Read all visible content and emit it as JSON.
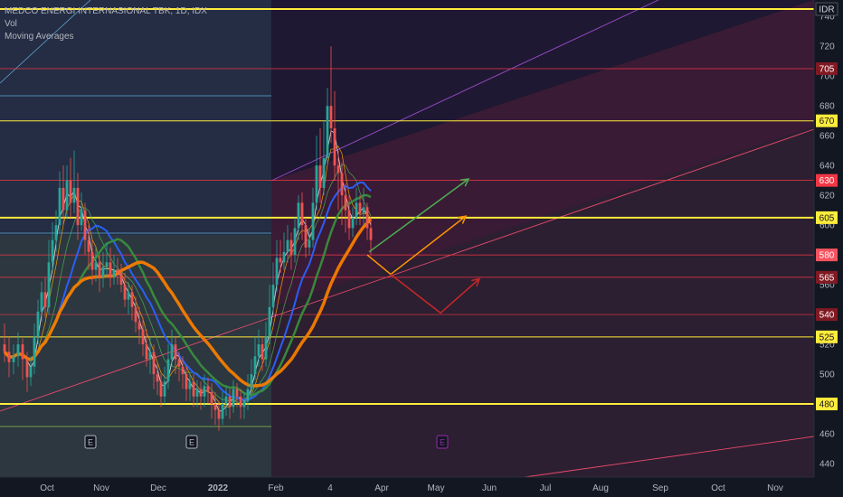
{
  "legend": {
    "title": "MEDCO ENERGI INTERNASIONAL TBK, 1D, IDX",
    "indicator_1": "Vol",
    "indicator_2": "Moving Averages"
  },
  "chart_data": {
    "type": "candlestick",
    "currency": "IDR",
    "y_ticks": [
      440,
      460,
      480,
      500,
      520,
      540,
      560,
      580,
      600,
      620,
      640,
      660,
      680,
      700,
      720,
      740
    ],
    "ylim": [
      432,
      745
    ],
    "x_ticks": [
      {
        "label": "Oct",
        "pos": 52
      },
      {
        "label": "Nov",
        "pos": 112
      },
      {
        "label": "Dec",
        "pos": 175
      },
      {
        "label": "2022",
        "pos": 241
      },
      {
        "label": "Feb",
        "pos": 305
      },
      {
        "label": "4",
        "pos": 365
      },
      {
        "label": "Apr",
        "pos": 422
      },
      {
        "label": "May",
        "pos": 482
      },
      {
        "label": "Jun",
        "pos": 541
      },
      {
        "label": "Jul",
        "pos": 603
      },
      {
        "label": "Aug",
        "pos": 664
      },
      {
        "label": "Sep",
        "pos": 730
      },
      {
        "label": "Oct",
        "pos": 794
      },
      {
        "label": "Nov",
        "pos": 857
      }
    ],
    "horizontal_levels": [
      {
        "value": 745,
        "color": "#ffeb3b",
        "width": 2
      },
      {
        "value": 705,
        "color": "#f23645",
        "width": 0.7
      },
      {
        "value": 670,
        "color": "#ffeb3b",
        "width": 1
      },
      {
        "value": 630,
        "color": "#f23645",
        "width": 0.7
      },
      {
        "value": 605,
        "color": "#ffeb3b",
        "width": 2
      },
      {
        "value": 580,
        "color": "#f23645",
        "width": 0.7
      },
      {
        "value": 565,
        "color": "#f23645",
        "width": 0.7
      },
      {
        "value": 540,
        "color": "#f23645",
        "width": 0.7
      },
      {
        "value": 525,
        "color": "#ffeb3b",
        "width": 1
      },
      {
        "value": 480,
        "color": "#ffeb3b",
        "width": 2
      }
    ],
    "price_tags": [
      {
        "label": "IDR",
        "value": 745,
        "bg": "#131722",
        "fg": "#d1d4dc"
      },
      {
        "label": "705",
        "value": 705,
        "bg": "#801922",
        "fg": "#ffffff"
      },
      {
        "label": "670",
        "value": 670,
        "bg": "#ffeb3b",
        "fg": "#131722"
      },
      {
        "label": "630",
        "value": 630,
        "bg": "#f23645",
        "fg": "#ffffff"
      },
      {
        "label": "605",
        "value": 605,
        "bg": "#ffeb3b",
        "fg": "#131722"
      },
      {
        "label": "580",
        "value": 580,
        "bg": "#f7525f",
        "fg": "#ffffff"
      },
      {
        "label": "565",
        "value": 565,
        "bg": "#801922",
        "fg": "#ffffff"
      },
      {
        "label": "540",
        "value": 540,
        "bg": "#801922",
        "fg": "#ffffff"
      },
      {
        "label": "525",
        "value": 525,
        "bg": "#ffeb3b",
        "fg": "#131722"
      },
      {
        "label": "480",
        "value": 480,
        "bg": "#ffeb3b",
        "fg": "#131722"
      }
    ],
    "earnings_markers": [
      {
        "label": "E",
        "pos": 100,
        "color": "#b2b5be"
      },
      {
        "label": "E",
        "pos": 212,
        "color": "#b2b5be"
      },
      {
        "label": "E",
        "pos": 489,
        "color": "#9c27b0"
      }
    ],
    "candles": [
      [
        5,
        520,
        515,
        534,
        508
      ],
      [
        10,
        515,
        508,
        525,
        498
      ],
      [
        15,
        508,
        512,
        520,
        500
      ],
      [
        20,
        512,
        520,
        528,
        505
      ],
      [
        25,
        520,
        510,
        524,
        496
      ],
      [
        30,
        510,
        498,
        515,
        488
      ],
      [
        34,
        498,
        505,
        512,
        492
      ],
      [
        38,
        505,
        525,
        534,
        500
      ],
      [
        42,
        525,
        542,
        550,
        520
      ],
      [
        46,
        542,
        555,
        562,
        535
      ],
      [
        50,
        555,
        545,
        565,
        538
      ],
      [
        54,
        545,
        575,
        590,
        540
      ],
      [
        58,
        575,
        590,
        602,
        570
      ],
      [
        62,
        590,
        600,
        610,
        582
      ],
      [
        66,
        600,
        625,
        636,
        595
      ],
      [
        70,
        625,
        610,
        640,
        600
      ],
      [
        74,
        610,
        630,
        640,
        604
      ],
      [
        78,
        630,
        615,
        645,
        605
      ],
      [
        82,
        615,
        625,
        650,
        608
      ],
      [
        86,
        625,
        600,
        635,
        590
      ],
      [
        90,
        600,
        610,
        622,
        596
      ],
      [
        94,
        610,
        590,
        615,
        580
      ],
      [
        98,
        590,
        582,
        600,
        570
      ],
      [
        102,
        582,
        570,
        590,
        560
      ],
      [
        106,
        570,
        575,
        585,
        562
      ],
      [
        110,
        575,
        565,
        580,
        555
      ],
      [
        114,
        565,
        572,
        582,
        558
      ],
      [
        118,
        572,
        575,
        588,
        565
      ],
      [
        122,
        575,
        565,
        585,
        558
      ],
      [
        126,
        565,
        570,
        580,
        560
      ],
      [
        130,
        570,
        568,
        578,
        560
      ],
      [
        134,
        568,
        560,
        574,
        555
      ],
      [
        138,
        560,
        550,
        568,
        545
      ],
      [
        142,
        550,
        555,
        562,
        540
      ],
      [
        146,
        555,
        545,
        560,
        536
      ],
      [
        150,
        545,
        535,
        552,
        528
      ],
      [
        154,
        535,
        530,
        545,
        520
      ],
      [
        158,
        530,
        520,
        538,
        512
      ],
      [
        162,
        520,
        510,
        530,
        505
      ],
      [
        166,
        510,
        515,
        525,
        500
      ],
      [
        170,
        515,
        500,
        520,
        490
      ],
      [
        174,
        500,
        495,
        508,
        486
      ],
      [
        178,
        495,
        485,
        500,
        478
      ],
      [
        182,
        485,
        495,
        505,
        480
      ],
      [
        186,
        495,
        510,
        520,
        490
      ],
      [
        190,
        510,
        520,
        530,
        505
      ],
      [
        194,
        520,
        510,
        525,
        500
      ],
      [
        198,
        510,
        505,
        515,
        495
      ],
      [
        202,
        505,
        500,
        512,
        490
      ],
      [
        206,
        500,
        490,
        505,
        482
      ],
      [
        210,
        490,
        495,
        500,
        482
      ],
      [
        214,
        495,
        485,
        500,
        478
      ],
      [
        218,
        485,
        490,
        496,
        478
      ],
      [
        222,
        490,
        485,
        495,
        476
      ],
      [
        226,
        485,
        492,
        500,
        478
      ],
      [
        230,
        492,
        488,
        498,
        480
      ],
      [
        234,
        488,
        480,
        494,
        470
      ],
      [
        238,
        480,
        476,
        488,
        466
      ],
      [
        242,
        476,
        470,
        482,
        462
      ],
      [
        246,
        470,
        480,
        488,
        466
      ],
      [
        250,
        480,
        485,
        492,
        472
      ],
      [
        254,
        485,
        478,
        490,
        470
      ],
      [
        258,
        478,
        490,
        496,
        474
      ],
      [
        262,
        490,
        485,
        494,
        478
      ],
      [
        266,
        485,
        478,
        490,
        470
      ],
      [
        270,
        478,
        482,
        488,
        470
      ],
      [
        274,
        482,
        490,
        500,
        476
      ],
      [
        278,
        490,
        500,
        510,
        484
      ],
      [
        282,
        500,
        512,
        525,
        496
      ],
      [
        286,
        512,
        520,
        530,
        505
      ],
      [
        290,
        520,
        510,
        525,
        502
      ],
      [
        294,
        510,
        525,
        535,
        505
      ],
      [
        298,
        525,
        545,
        560,
        520
      ],
      [
        302,
        545,
        560,
        575,
        540
      ],
      [
        306,
        560,
        578,
        590,
        555
      ],
      [
        310,
        578,
        575,
        590,
        568
      ],
      [
        314,
        575,
        582,
        595,
        570
      ],
      [
        318,
        582,
        590,
        600,
        575
      ],
      [
        322,
        590,
        580,
        595,
        570
      ],
      [
        326,
        580,
        598,
        605,
        575
      ],
      [
        330,
        598,
        615,
        620,
        590
      ],
      [
        334,
        615,
        600,
        622,
        590
      ],
      [
        338,
        600,
        585,
        605,
        578
      ],
      [
        342,
        585,
        590,
        598,
        580
      ],
      [
        346,
        590,
        615,
        625,
        585
      ],
      [
        350,
        615,
        640,
        660,
        610
      ],
      [
        354,
        640,
        625,
        665,
        615
      ],
      [
        358,
        625,
        645,
        670,
        620
      ],
      [
        362,
        645,
        680,
        692,
        640
      ],
      [
        366,
        680,
        665,
        720,
        655
      ],
      [
        370,
        665,
        640,
        690,
        630
      ],
      [
        374,
        640,
        635,
        650,
        610
      ],
      [
        378,
        635,
        620,
        642,
        600
      ],
      [
        382,
        620,
        610,
        628,
        595
      ],
      [
        386,
        610,
        598,
        620,
        590
      ],
      [
        390,
        598,
        605,
        612,
        592
      ],
      [
        394,
        605,
        615,
        625,
        600
      ],
      [
        398,
        615,
        608,
        620,
        600
      ],
      [
        402,
        608,
        612,
        625,
        600
      ],
      [
        406,
        612,
        598,
        615,
        590
      ],
      [
        410,
        598,
        590,
        605,
        580
      ]
    ],
    "moving_averages": [
      {
        "name": "MA5",
        "color": "#ffffff",
        "width": 0.8
      },
      {
        "name": "MA10",
        "color": "#f7a600",
        "width": 0.8
      },
      {
        "name": "MA20",
        "color": "#4caf50",
        "width": 0.8
      },
      {
        "name": "MA50",
        "color": "#2962ff",
        "width": 2
      },
      {
        "name": "MA100",
        "color": "#388e3c",
        "width": 2.5
      },
      {
        "name": "MA200",
        "color": "#f57c00",
        "width": 3.5
      }
    ],
    "projection_arrows": [
      {
        "color": "#4caf50",
        "points": [
          [
            408,
            582
          ],
          [
            518,
            631
          ]
        ]
      },
      {
        "color": "#ff9800",
        "points": [
          [
            406,
            580
          ],
          [
            432,
            567
          ],
          [
            515,
            606
          ]
        ]
      },
      {
        "color": "#c62828",
        "points": [
          [
            432,
            567
          ],
          [
            487,
            541
          ],
          [
            530,
            564
          ]
        ]
      }
    ]
  }
}
